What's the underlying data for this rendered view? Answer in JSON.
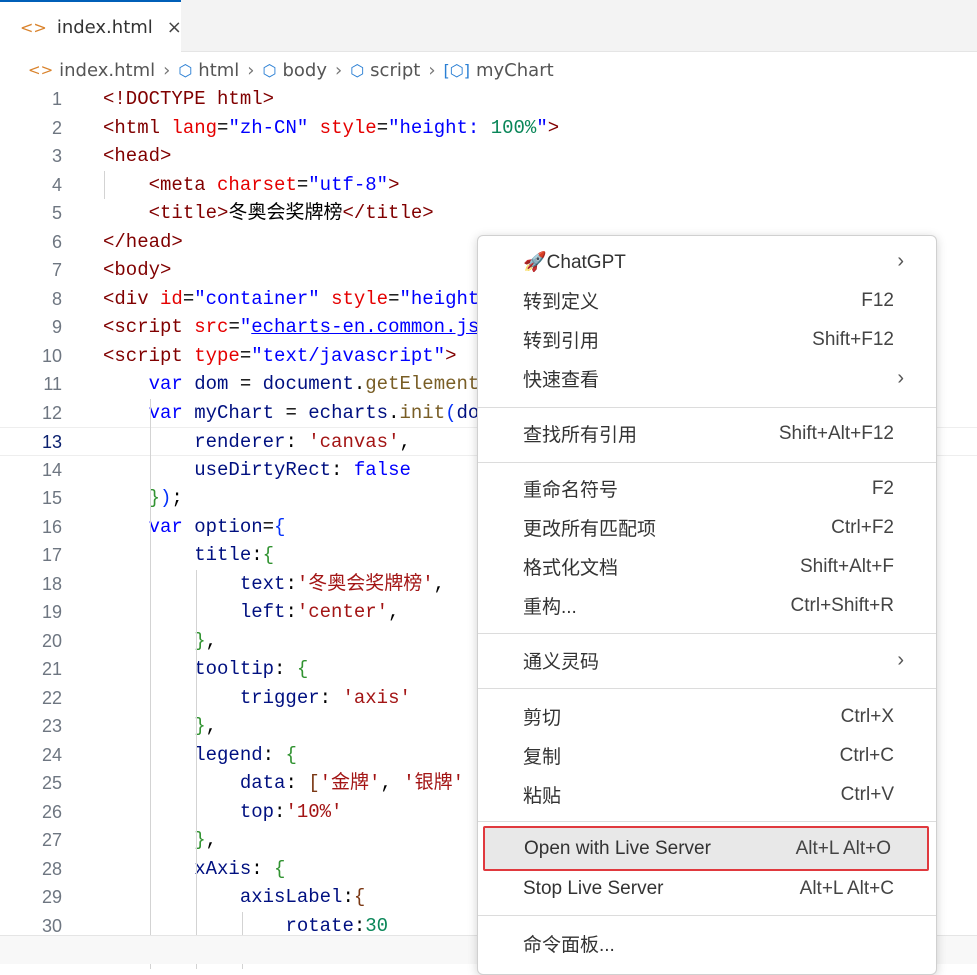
{
  "tab": {
    "label": "index.html",
    "close": "×"
  },
  "breadcrumb": [
    "index.html",
    "html",
    "body",
    "script",
    "myChart"
  ],
  "code": [
    [
      [
        "<!DOCTYPE ",
        "t"
      ],
      [
        "html",
        "t"
      ],
      [
        ">",
        "t"
      ]
    ],
    [
      [
        "<html ",
        "t"
      ],
      [
        "lang",
        "a"
      ],
      [
        "=",
        "p"
      ],
      [
        "\"zh-CN\"",
        "s"
      ],
      [
        " ",
        "p"
      ],
      [
        "style",
        "a"
      ],
      [
        "=",
        "p"
      ],
      [
        "\"height: ",
        "s"
      ],
      [
        "100%",
        "n"
      ],
      [
        "\"",
        "s"
      ],
      [
        ">",
        "t"
      ]
    ],
    [
      [
        "<head>",
        "t"
      ]
    ],
    [
      [
        "    ",
        "p"
      ],
      [
        "<meta ",
        "t"
      ],
      [
        "charset",
        "a"
      ],
      [
        "=",
        "p"
      ],
      [
        "\"utf-8\"",
        "s"
      ],
      [
        ">",
        "t"
      ]
    ],
    [
      [
        "    ",
        "p"
      ],
      [
        "<title>",
        "t"
      ],
      [
        "冬奥会奖牌榜",
        "p"
      ],
      [
        "</title>",
        "t"
      ]
    ],
    [
      [
        "</head>",
        "t"
      ]
    ],
    [
      [
        "<body>",
        "t"
      ]
    ],
    [
      [
        "<div ",
        "t"
      ],
      [
        "id",
        "a"
      ],
      [
        "=",
        "p"
      ],
      [
        "\"container\"",
        "s"
      ],
      [
        " ",
        "p"
      ],
      [
        "style",
        "a"
      ],
      [
        "=",
        "p"
      ],
      [
        "\"height",
        "s"
      ],
      [
        "                                 ",
        "p"
      ],
      [
        ";\"",
        "s"
      ],
      [
        "><",
        "t"
      ]
    ],
    [
      [
        "<script ",
        "t"
      ],
      [
        "src",
        "a"
      ],
      [
        "=",
        "p"
      ],
      [
        "\"",
        "s"
      ],
      [
        "echarts-en.common.js",
        "u"
      ]
    ],
    [
      [
        "<script ",
        "t"
      ],
      [
        "type",
        "a"
      ],
      [
        "=",
        "p"
      ],
      [
        "\"text/javascript\"",
        "s"
      ],
      [
        ">",
        "t"
      ]
    ],
    [
      [
        "    ",
        "p"
      ],
      [
        "var ",
        "k"
      ],
      [
        "dom",
        "v"
      ],
      [
        " = ",
        "p"
      ],
      [
        "document",
        "v"
      ],
      [
        ".",
        "p"
      ],
      [
        "getElement",
        "f"
      ]
    ],
    [
      [
        "    ",
        "p"
      ],
      [
        "var ",
        "k"
      ],
      [
        "myChart",
        "v"
      ],
      [
        " = ",
        "p"
      ],
      [
        "echarts",
        "v"
      ],
      [
        ".",
        "p"
      ],
      [
        "init",
        "f"
      ],
      [
        "(",
        "b1"
      ],
      [
        "do",
        "v"
      ]
    ],
    [
      [
        "        ",
        "p"
      ],
      [
        "renderer",
        "v"
      ],
      [
        ": ",
        "p"
      ],
      [
        "'canvas'",
        "js"
      ],
      [
        ",",
        "p"
      ]
    ],
    [
      [
        "        ",
        "p"
      ],
      [
        "useDirtyRect",
        "v"
      ],
      [
        ": ",
        "p"
      ],
      [
        "false",
        "k"
      ]
    ],
    [
      [
        "    ",
        "p"
      ],
      [
        "}",
        "b2"
      ],
      [
        ")",
        "b1"
      ],
      [
        ";",
        "p"
      ]
    ],
    [
      [
        "    ",
        "p"
      ],
      [
        "var ",
        "k"
      ],
      [
        "option",
        "v"
      ],
      [
        "=",
        "p"
      ],
      [
        "{",
        "b1"
      ]
    ],
    [
      [
        "        ",
        "p"
      ],
      [
        "title",
        "v"
      ],
      [
        ":",
        "p"
      ],
      [
        "{",
        "b2"
      ]
    ],
    [
      [
        "            ",
        "p"
      ],
      [
        "text",
        "v"
      ],
      [
        ":",
        "p"
      ],
      [
        "'冬奥会奖牌榜'",
        "js"
      ],
      [
        ",",
        "p"
      ]
    ],
    [
      [
        "            ",
        "p"
      ],
      [
        "left",
        "v"
      ],
      [
        ":",
        "p"
      ],
      [
        "'center'",
        "js"
      ],
      [
        ",",
        "p"
      ]
    ],
    [
      [
        "        ",
        "p"
      ],
      [
        "}",
        "b2"
      ],
      [
        ",",
        "p"
      ]
    ],
    [
      [
        "        ",
        "p"
      ],
      [
        "tooltip",
        "v"
      ],
      [
        ": ",
        "p"
      ],
      [
        "{",
        "b2"
      ]
    ],
    [
      [
        "            ",
        "p"
      ],
      [
        "trigger",
        "v"
      ],
      [
        ": ",
        "p"
      ],
      [
        "'axis'",
        "js"
      ]
    ],
    [
      [
        "        ",
        "p"
      ],
      [
        "}",
        "b2"
      ],
      [
        ",",
        "p"
      ]
    ],
    [
      [
        "        ",
        "p"
      ],
      [
        "legend",
        "v"
      ],
      [
        ": ",
        "p"
      ],
      [
        "{",
        "b2"
      ]
    ],
    [
      [
        "            ",
        "p"
      ],
      [
        "data",
        "v"
      ],
      [
        ": ",
        "p"
      ],
      [
        "[",
        "b3"
      ],
      [
        "'金牌'",
        "js"
      ],
      [
        ", ",
        "p"
      ],
      [
        "'银牌'",
        "js"
      ]
    ],
    [
      [
        "            ",
        "p"
      ],
      [
        "top",
        "v"
      ],
      [
        ":",
        "p"
      ],
      [
        "'10%'",
        "js"
      ]
    ],
    [
      [
        "        ",
        "p"
      ],
      [
        "}",
        "b2"
      ],
      [
        ",",
        "p"
      ]
    ],
    [
      [
        "        ",
        "p"
      ],
      [
        "xAxis",
        "v"
      ],
      [
        ": ",
        "p"
      ],
      [
        "{",
        "b2"
      ]
    ],
    [
      [
        "            ",
        "p"
      ],
      [
        "axisLabel",
        "v"
      ],
      [
        ":",
        "p"
      ],
      [
        "{",
        "b3"
      ]
    ],
    [
      [
        "                ",
        "p"
      ],
      [
        "rotate",
        "v"
      ],
      [
        ":",
        "p"
      ],
      [
        "30",
        "n"
      ]
    ]
  ],
  "current_line": 13,
  "context_menu": [
    {
      "label": "🚀ChatGPT",
      "shortcut": "",
      "submenu": true
    },
    {
      "label": "转到定义",
      "shortcut": "F12"
    },
    {
      "label": "转到引用",
      "shortcut": "Shift+F12"
    },
    {
      "label": "快速查看",
      "shortcut": "",
      "submenu": true
    },
    {
      "label": "查找所有引用",
      "shortcut": "Shift+Alt+F12"
    },
    {
      "label": "重命名符号",
      "shortcut": "F2"
    },
    {
      "label": "更改所有匹配项",
      "shortcut": "Ctrl+F2"
    },
    {
      "label": "格式化文档",
      "shortcut": "Shift+Alt+F"
    },
    {
      "label": "重构...",
      "shortcut": "Ctrl+Shift+R"
    },
    {
      "label": "通义灵码",
      "shortcut": "",
      "submenu": true
    },
    {
      "label": "剪切",
      "shortcut": "Ctrl+X"
    },
    {
      "label": "复制",
      "shortcut": "Ctrl+C"
    },
    {
      "label": "粘贴",
      "shortcut": "Ctrl+V"
    },
    {
      "label": "Open with Live Server",
      "shortcut": "Alt+L Alt+O",
      "highlighted": true
    },
    {
      "label": "Stop Live Server",
      "shortcut": "Alt+L Alt+C"
    },
    {
      "label": "命令面板...",
      "shortcut": ""
    }
  ]
}
